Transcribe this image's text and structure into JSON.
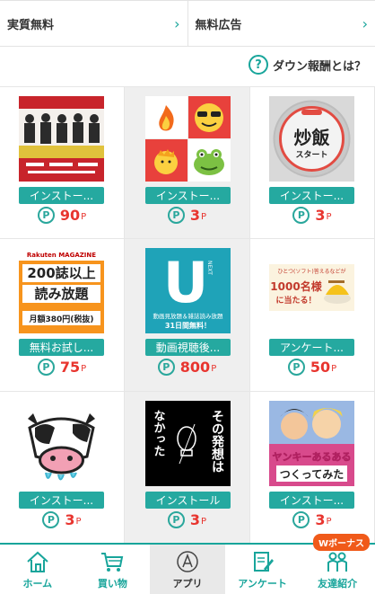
{
  "header": {
    "tabs": [
      {
        "label": "実質無料"
      },
      {
        "label": "無料広告"
      }
    ]
  },
  "help": {
    "label": "ダウン報酬とは？",
    "icon": "question-icon"
  },
  "apps": [
    {
      "name": "app-thumb-comedians",
      "label": "インストー...",
      "points": "90",
      "unit": "P"
    },
    {
      "name": "app-thumb-emoji",
      "label": "インストー...",
      "points": "3",
      "unit": "P"
    },
    {
      "name": "app-thumb-fried-rice",
      "thumb_text": "炒飯",
      "thumb_sub": "スタート",
      "label": "インストー...",
      "points": "3",
      "unit": "P"
    },
    {
      "name": "app-thumb-rakuten-magazine",
      "thumb_brand": "Rakuten MAGAZINE",
      "thumb_line1": "200誌以上",
      "thumb_line2": "読み放題",
      "thumb_line3": "月額380円(税抜)",
      "label": "無料お試し...",
      "points": "75",
      "unit": "P"
    },
    {
      "name": "app-thumb-unext",
      "thumb_letter": "U",
      "thumb_small": "NEXT",
      "thumb_line1": "動画見放題＆雑誌読み放題",
      "thumb_line2": "31日間無料！",
      "label": "動画視聴後...",
      "points": "800",
      "unit": "P"
    },
    {
      "name": "app-thumb-survey-gift",
      "thumb_line1": "ひとつ(ソフト)答えるなどが",
      "thumb_line2": "1000名様",
      "thumb_line3": "に当たる！",
      "label": "アンケート...",
      "points": "50",
      "unit": "P"
    },
    {
      "name": "app-thumb-cow",
      "label": "インストー...",
      "points": "3",
      "unit": "P"
    },
    {
      "name": "app-thumb-idea",
      "thumb_line1": "その発想は",
      "thumb_line2": "なかった",
      "label": "インストール",
      "points": "3",
      "unit": "P"
    },
    {
      "name": "app-thumb-yankee",
      "thumb_line1": "ヤンキーあるある",
      "thumb_line2": "つくってみた",
      "label": "インストー...",
      "points": "3",
      "unit": "P"
    }
  ],
  "nav": [
    {
      "label": "ホーム",
      "icon": "home-icon"
    },
    {
      "label": "買い物",
      "icon": "cart-icon"
    },
    {
      "label": "アプリ",
      "icon": "app-a-icon",
      "active": true
    },
    {
      "label": "アンケート",
      "icon": "survey-pen-icon"
    },
    {
      "label": "友達紹介",
      "icon": "friends-icon",
      "badge": "Wボーナス"
    }
  ],
  "colors": {
    "accent": "#18a59b",
    "points": "#e8352f",
    "badge": "#f05a1a"
  }
}
